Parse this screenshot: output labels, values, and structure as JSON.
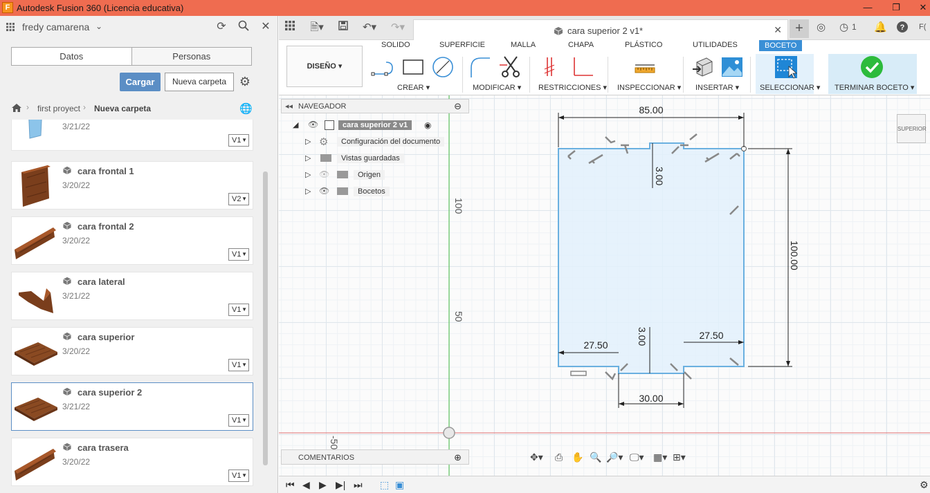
{
  "window": {
    "app_icon": "F",
    "title": "Autodesk Fusion 360 (Licencia educativa)",
    "controls": [
      "minimize-icon",
      "restore-icon",
      "close-icon"
    ]
  },
  "data_panel": {
    "user_name": "fredy camarena",
    "tabs": [
      "Datos",
      "Personas"
    ],
    "upload_label": "Cargar",
    "new_folder_label": "Nueva carpeta",
    "breadcrumb": [
      "first proyect",
      "Nueva carpeta"
    ],
    "files": [
      {
        "name": "",
        "date": "3/21/22",
        "version": "V1",
        "thumb": "blue"
      },
      {
        "name": "cara frontal 1",
        "date": "3/20/22",
        "version": "V2",
        "thumb": "plank-vertical"
      },
      {
        "name": "cara frontal 2",
        "date": "3/20/22",
        "version": "V1",
        "thumb": "plank-diagonal"
      },
      {
        "name": "cara lateral",
        "date": "3/21/22",
        "version": "V1",
        "thumb": "plank-cut"
      },
      {
        "name": "cara superior",
        "date": "3/20/22",
        "version": "V1",
        "thumb": "plank-flat"
      },
      {
        "name": "cara superior 2",
        "date": "3/21/22",
        "version": "V1",
        "thumb": "plank-flat",
        "selected": true
      },
      {
        "name": "cara trasera",
        "date": "3/20/22",
        "version": "V1",
        "thumb": "plank-diagonal"
      }
    ]
  },
  "document": {
    "tab_name": "cara superior 2 v1*",
    "right_badge": "1",
    "user_initials": "F("
  },
  "ribbon": {
    "workspace": "DISEÑO",
    "tabs": [
      "SOLIDO",
      "SUPERFICIE",
      "MALLA",
      "CHAPA",
      "PLÁSTICO",
      "UTILIDADES",
      "BOCETO"
    ],
    "active_tab": "BOCETO",
    "groups": [
      "CREAR",
      "MODIFICAR",
      "RESTRICCIONES",
      "INSPECCIONAR",
      "INSERTAR",
      "SELECCIONAR",
      "TERMINAR BOCETO"
    ]
  },
  "browser": {
    "title": "NAVEGADOR",
    "root": "cara superior 2 v1",
    "items": [
      "Configuración del documento",
      "Vistas guardadas",
      "Origen",
      "Bocetos"
    ],
    "comments_title": "COMENTARIOS"
  },
  "sketch": {
    "dim_width": "85.00",
    "dim_height": "100.00",
    "dim_top_notch": "3.00",
    "dim_bottom_notch": "3.00",
    "dim_left_offset": "27.50",
    "dim_right_offset": "27.50",
    "dim_notch_width": "30.00",
    "axis_label_100": "100",
    "axis_label_50": "50",
    "axis_label_neg50": "-50"
  },
  "viewcube_label": "SUPERIOR",
  "colors": {
    "title_bar": "#ef6c50",
    "accent": "#3a8fd6",
    "profile_fill": "#e2f0fb",
    "sketch_line": "#6ab0e0"
  }
}
